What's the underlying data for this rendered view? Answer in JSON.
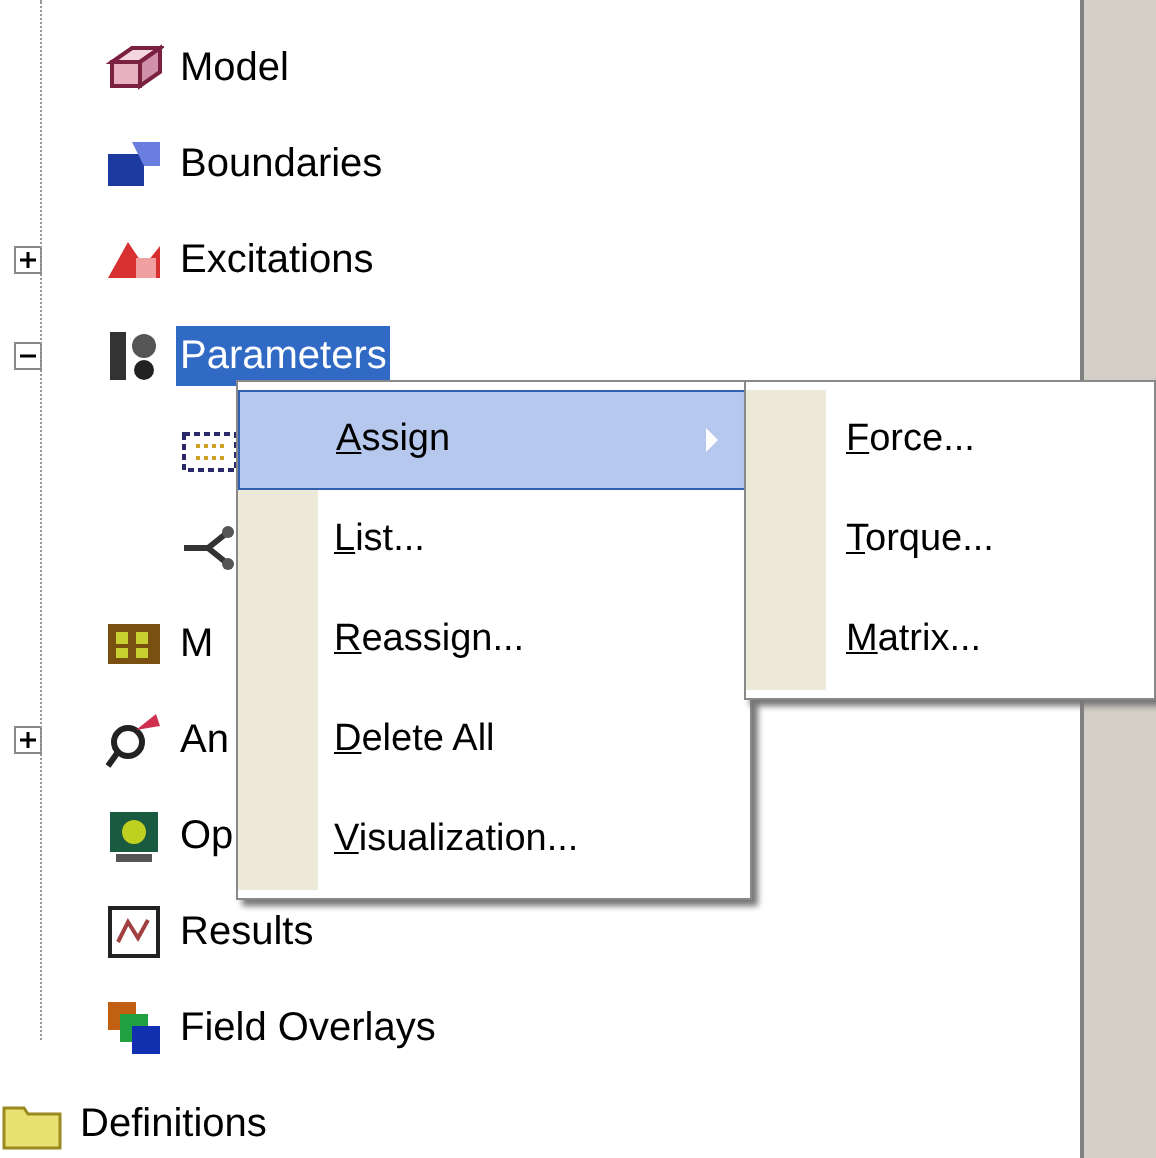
{
  "tree": [
    {
      "label": "Model",
      "selected": false
    },
    {
      "label": "Boundaries",
      "selected": false
    },
    {
      "label": "Excitations",
      "selected": false,
      "expanded": false
    },
    {
      "label": "Parameters",
      "selected": true,
      "expanded": true,
      "children": [
        {
          "selected": false
        },
        {
          "selected": false
        }
      ]
    },
    {
      "label": "M",
      "selected": false
    },
    {
      "label": "An",
      "selected": false,
      "expanded": false
    },
    {
      "label": "Op",
      "selected": false
    },
    {
      "label": "Results",
      "selected": false
    },
    {
      "label": "Field Overlays",
      "selected": false
    }
  ],
  "definitions": {
    "label": "Definitions"
  },
  "context_menu": {
    "items": [
      {
        "label": "Assign",
        "selected": true,
        "submenu": true,
        "underline_first": true
      },
      {
        "label": "List...",
        "selected": false,
        "submenu": false,
        "underline_first": true
      },
      {
        "label": "Reassign...",
        "selected": false,
        "submenu": false,
        "underline_first": true
      },
      {
        "label": "Delete All",
        "selected": false,
        "submenu": false,
        "underline_first": true
      },
      {
        "label": "Visualization...",
        "selected": false,
        "submenu": false,
        "underline_first": true
      }
    ]
  },
  "submenu": {
    "items": [
      {
        "label": "Force...",
        "underline_first": true
      },
      {
        "label": "Torque...",
        "underline_first": true
      },
      {
        "label": "Matrix...",
        "underline_first": true
      }
    ]
  }
}
